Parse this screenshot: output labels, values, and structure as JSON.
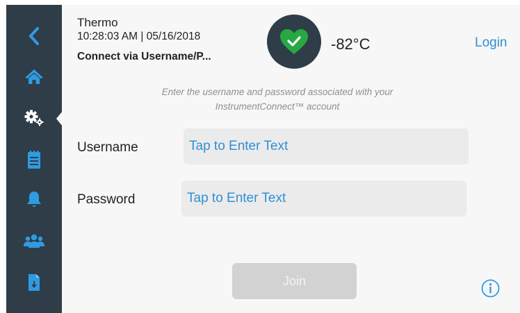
{
  "header": {
    "title": "Thermo",
    "datetime": "10:28:03 AM | 05/16/2018",
    "subtitle": "Connect via Username/P...",
    "temperature": "-82°C",
    "login_label": "Login",
    "status_icon": "heart-check-icon",
    "status_color": "#27a844"
  },
  "sidebar": {
    "items": [
      {
        "icon": "back-chevron-icon"
      },
      {
        "icon": "home-icon"
      },
      {
        "icon": "settings-gears-icon",
        "active": true
      },
      {
        "icon": "clipboard-icon"
      },
      {
        "icon": "bell-icon"
      },
      {
        "icon": "users-icon"
      },
      {
        "icon": "file-download-icon"
      }
    ],
    "icon_color": "#2f9be3"
  },
  "form": {
    "instructions_line1": "Enter the username and password associated with your",
    "instructions_line2": "InstrumentConnect™ account",
    "username_label": "Username",
    "username_placeholder": "Tap to Enter Text",
    "password_label": "Password",
    "password_placeholder": "Tap to Enter Text",
    "join_label": "Join"
  },
  "colors": {
    "sidebar_bg": "#2f3d48",
    "accent": "#2f8fd6",
    "disabled_button": "#d2d2d2"
  }
}
